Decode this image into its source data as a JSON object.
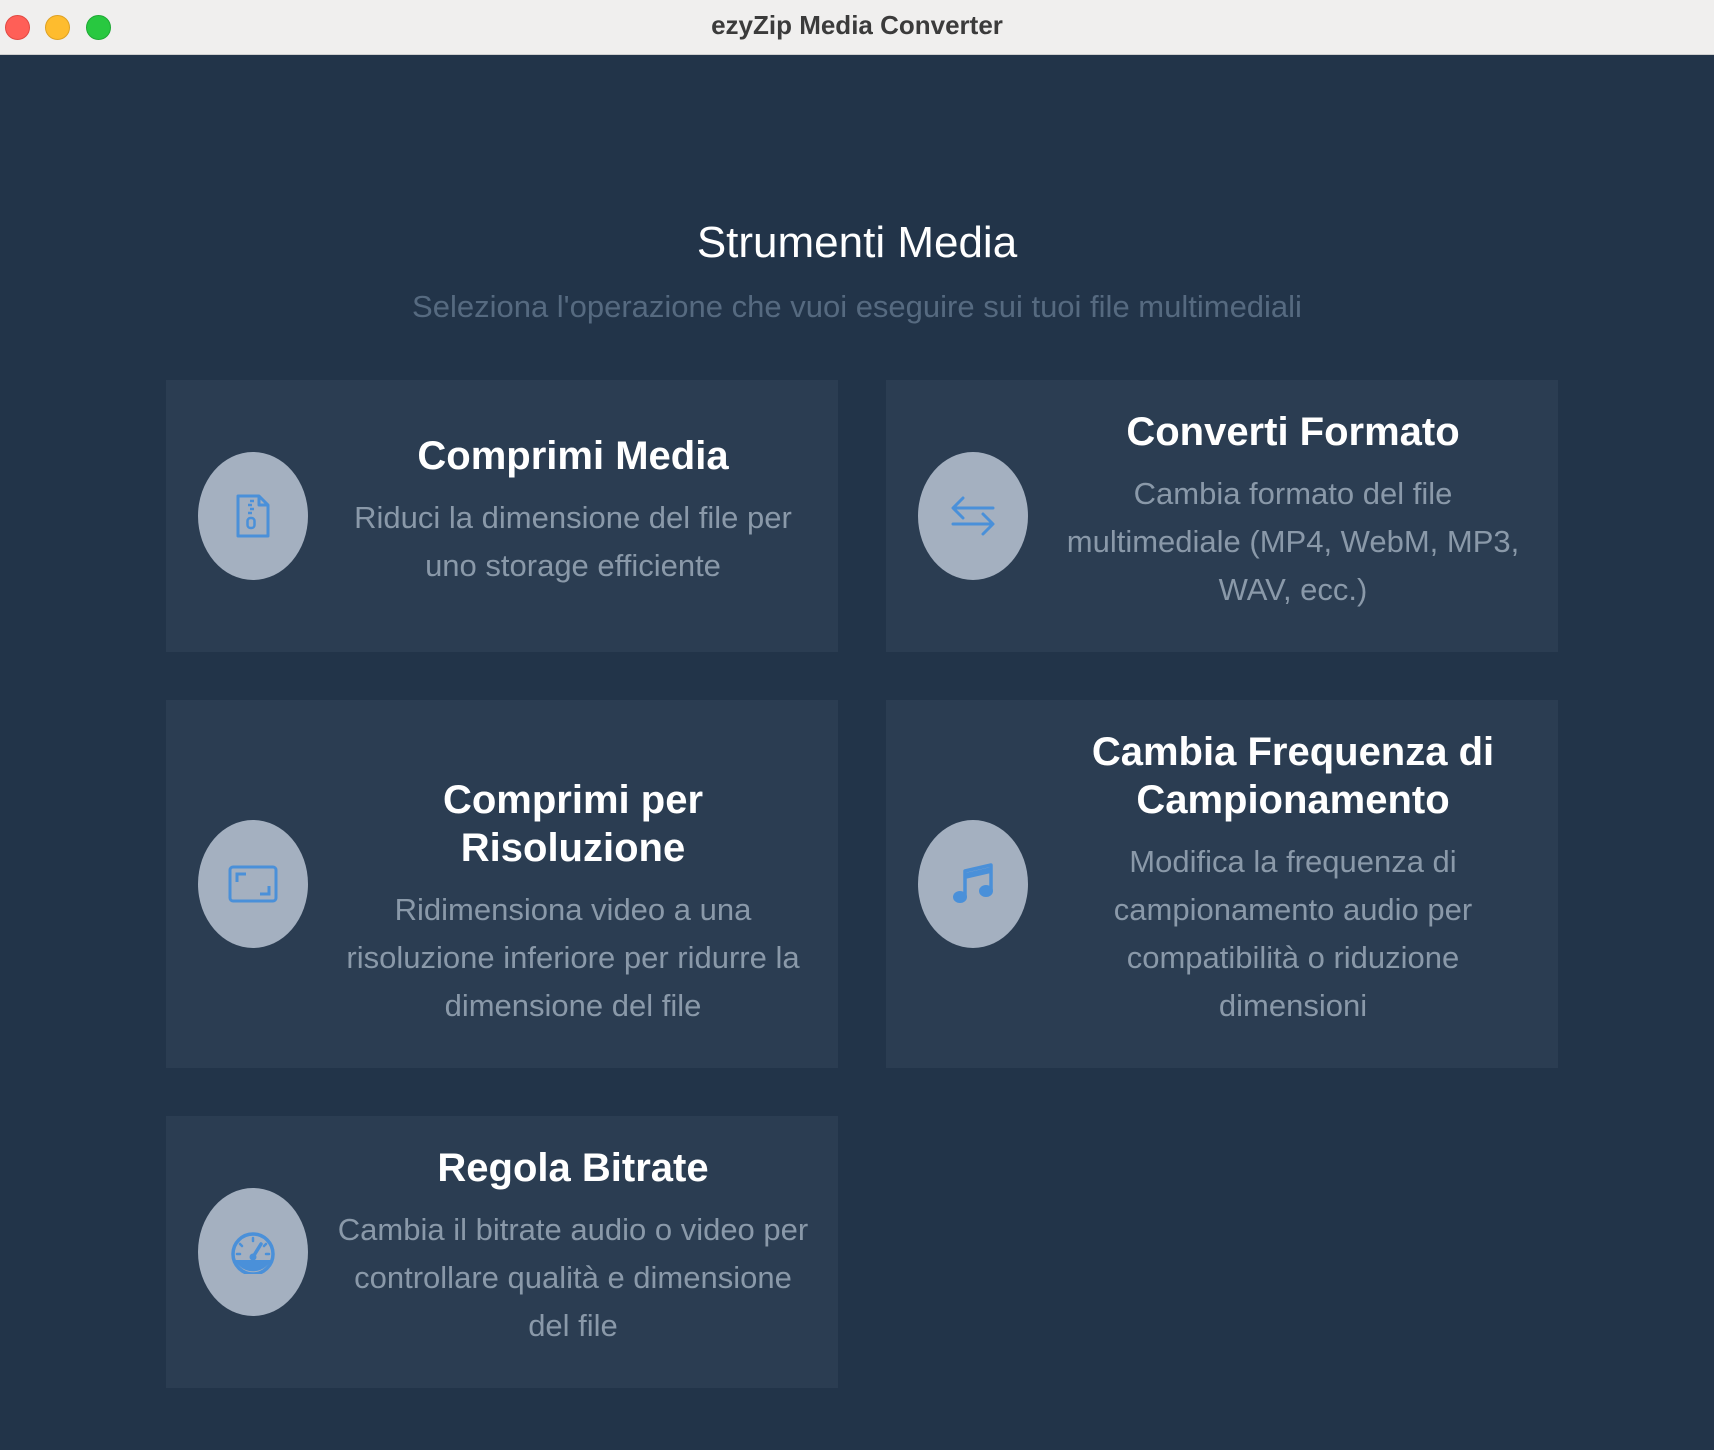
{
  "window": {
    "title": "ezyZip Media Converter"
  },
  "header": {
    "title": "Strumenti Media",
    "subtitle": "Seleziona l'operazione che vuoi eseguire sui tuoi file multimediali"
  },
  "tools": [
    {
      "title": "Comprimi Media",
      "description": "Riduci la dimensione del file per uno storage efficiente",
      "icon": "zip-file-icon"
    },
    {
      "title": "Converti Formato",
      "description": "Cambia formato del file multimediale (MP4, WebM, MP3, WAV, ecc.)",
      "icon": "swap-arrows-icon"
    },
    {
      "title": "Comprimi per Risoluzione",
      "description": "Ridimensiona video a una risoluzione inferiore per ridurre la dimensione del file",
      "icon": "resize-frame-icon"
    },
    {
      "title": "Cambia Frequenza di Campionamento",
      "description": "Modifica la frequenza di campionamento audio per compatibilità o riduzione dimensioni",
      "icon": "music-note-icon"
    },
    {
      "title": "Regola Bitrate",
      "description": "Cambia il bitrate audio o video per controllare qualità e dimensione del file",
      "icon": "gauge-icon"
    }
  ],
  "colors": {
    "background": "#223449",
    "card": "#2b3d52",
    "icon_circle": "#a4b0c0",
    "icon_accent": "#4a90d9",
    "title_text": "#ffffff",
    "desc_text": "#8a99a9"
  }
}
